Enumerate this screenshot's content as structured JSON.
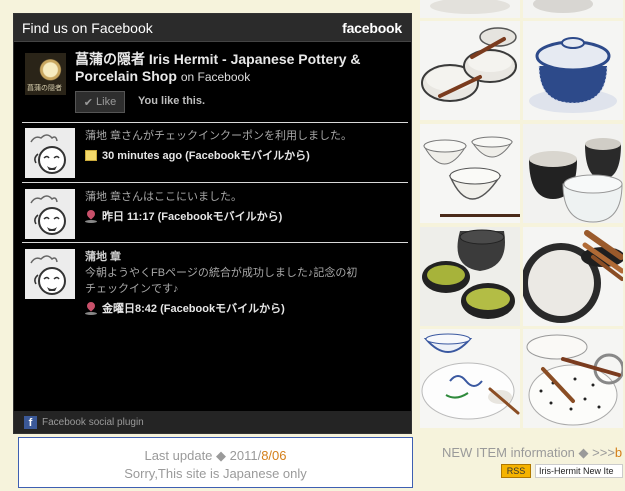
{
  "fb_widget": {
    "header_title": "Find us on Facebook",
    "wordmark": "facebook",
    "page_name": "菖蒲の隠者 Iris Hermit - Japanese Pottery & Porcelain Shop",
    "page_on": "on Facebook",
    "logo_caption": "菖蒲の隠者",
    "like_button_label": "Like",
    "like_status": "You like this.",
    "posts": [
      {
        "text": "蒲地 章さんがチェックインクーポンを利用しました。",
        "meta_icon": "coupon-icon",
        "meta": "30 minutes ago (Facebookモバイルから)"
      },
      {
        "text": "蒲地 章さんはここにいました。",
        "meta_icon": "pin-icon",
        "meta": "昨日 11:17 (Facebookモバイルから)"
      },
      {
        "name": "蒲地 章",
        "text_line1": "今朝ようやくFBページの統合が成功しました♪記念の初",
        "text_line2": "チェックインです♪",
        "meta_icon": "pin-icon",
        "meta": "金曜日8:42 (Facebookモバイルから)"
      }
    ],
    "footer": "Facebook social plugin"
  },
  "update_box": {
    "prefix": "Last update ◆ 2011/",
    "date": "8/06",
    "note": "Sorry,This site is Japanese only"
  },
  "new_item": {
    "label": "NEW ITEM information ◆ >>>",
    "tail": "b",
    "rss_badge": "RSS",
    "rss_feed_title": "Iris-Hermit New Ite"
  },
  "colors": {
    "accent_orange": "#d47f19",
    "facebook_blue": "#3b5998",
    "page_background": "#f6f3dc"
  }
}
